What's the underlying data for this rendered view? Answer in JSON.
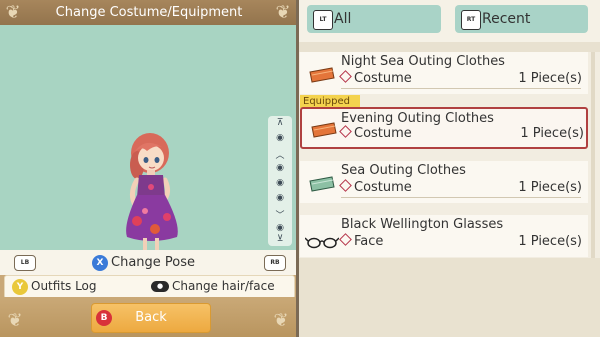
{
  "left": {
    "header_title": "Change Costume/Equipment",
    "pose": {
      "left_shoulder": "LB",
      "badge": "X",
      "label": "Change Pose",
      "right_shoulder": "RB"
    },
    "log": {
      "badge": "Y",
      "label": "Outfits Log",
      "stick_label": "Change hair/face"
    },
    "back": {
      "badge": "B",
      "label": "Back"
    }
  },
  "tabs": [
    {
      "icon": "LT",
      "label": "All"
    },
    {
      "icon": "RT",
      "label": "Recent"
    }
  ],
  "equipped_label": "Equipped",
  "items": [
    {
      "name": "Night Sea Outing Clothes",
      "type": "Costume",
      "qty": "1 Piece(s)",
      "icon": "folded-clothes-orange-icon"
    },
    {
      "name": "Evening Outing Clothes",
      "type": "Costume",
      "qty": "1 Piece(s)",
      "icon": "folded-clothes-orange-icon"
    },
    {
      "name": "Sea Outing Clothes",
      "type": "Costume",
      "qty": "1 Piece(s)",
      "icon": "folded-clothes-green-icon"
    },
    {
      "name": "Black Wellington Glasses",
      "type": "Face",
      "qty": "1 Piece(s)",
      "icon": "glasses-icon"
    }
  ],
  "colors": {
    "preview_bg": "#a8d4c2",
    "tab_bg": "#a9d3c7",
    "accent_red": "#b04040",
    "equipped_yellow": "#f4d34e",
    "back_orange": "#eda940"
  }
}
